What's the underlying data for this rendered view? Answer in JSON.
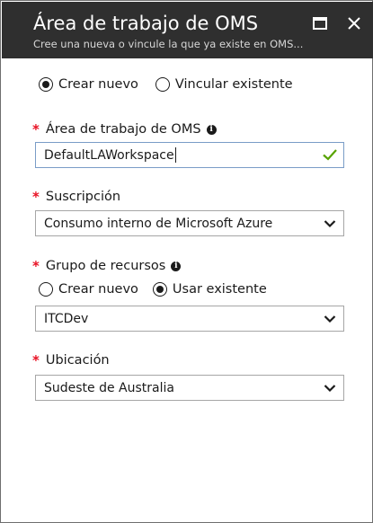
{
  "header": {
    "title": "Área de trabajo de OMS",
    "subtitle": "Cree una nueva o vincule la que ya existe en OMS..."
  },
  "mode": {
    "options": [
      "Crear nuevo",
      "Vincular existente"
    ],
    "selected": "Crear nuevo"
  },
  "workspace": {
    "label": "Área de trabajo de OMS",
    "value": "DefaultLAWorkspace"
  },
  "subscription": {
    "label": "Suscripción",
    "value": "Consumo interno de Microsoft Azure"
  },
  "resource_group": {
    "label": "Grupo de recursos",
    "options": [
      "Crear nuevo",
      "Usar existente"
    ],
    "selected": "Usar existente",
    "value": "ITCDev"
  },
  "location": {
    "label": "Ubicación",
    "value": "Sudeste de Australia"
  },
  "colors": {
    "header_bg": "#2f2f2f",
    "required": "#e81123",
    "valid_check": "#57a300",
    "field_border_active": "#7a9cc7"
  },
  "icons": [
    "maximize-icon",
    "close-icon",
    "info-icon",
    "checkmark-icon",
    "chevron-down-icon"
  ]
}
